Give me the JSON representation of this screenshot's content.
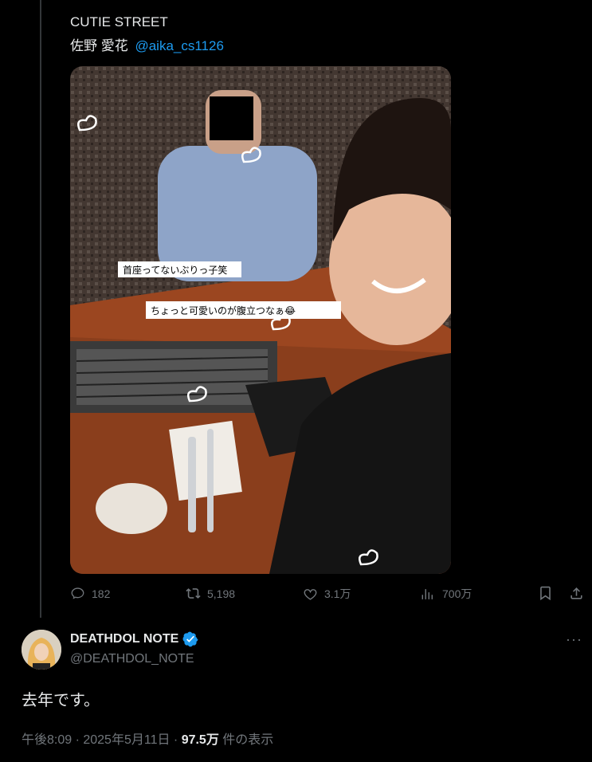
{
  "quoted": {
    "line1": "CUTIE STREET",
    "name": "佐野 愛花",
    "mention": "@aika_cs1126",
    "captions": [
      "首座ってないぶりっ子笑",
      "ちょっと可愛いのが腹立つなぁ😂"
    ]
  },
  "actions": {
    "replies": "182",
    "reposts": "5,198",
    "likes": "3.1万",
    "views": "700万"
  },
  "tweet": {
    "display_name": "DEATHDOL NOTE",
    "handle": "@DEATHDOL_NOTE",
    "text": "去年です。",
    "time": "午後8:09 · 2025年5月11日 · ",
    "views": "97.5万",
    "views_suffix": " 件の表示"
  },
  "colors": {
    "accent": "#1d9bf0",
    "muted": "#71767b",
    "text": "#e7e9ea",
    "background": "#000000"
  }
}
